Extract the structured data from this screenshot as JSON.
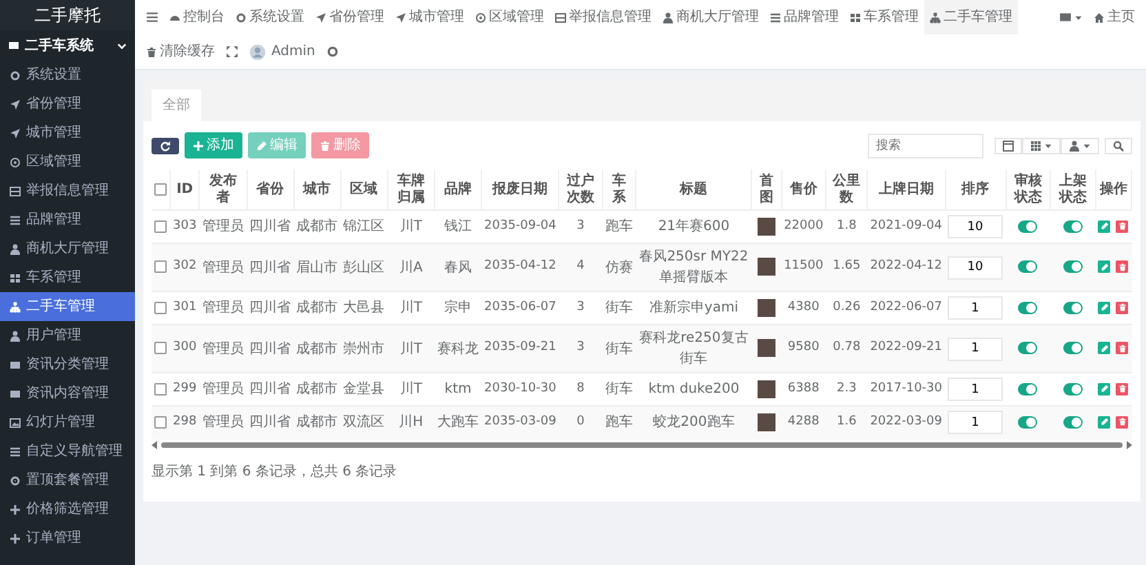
{
  "sidebar": {
    "brand": "二手摩托",
    "group": {
      "label": "二手车系统",
      "expanded": true
    },
    "items": [
      {
        "label": "系统设置",
        "selected": false
      },
      {
        "label": "省份管理",
        "selected": false
      },
      {
        "label": "城市管理",
        "selected": false
      },
      {
        "label": "区域管理",
        "selected": false
      },
      {
        "label": "举报信息管理",
        "selected": false
      },
      {
        "label": "品牌管理",
        "selected": false
      },
      {
        "label": "商机大厅管理",
        "selected": false
      },
      {
        "label": "车系管理",
        "selected": false
      },
      {
        "label": "二手车管理",
        "selected": true
      },
      {
        "label": "用户管理",
        "selected": false
      },
      {
        "label": "资讯分类管理",
        "selected": false
      },
      {
        "label": "资讯内容管理",
        "selected": false
      },
      {
        "label": "幻灯片管理",
        "selected": false
      },
      {
        "label": "自定义导航管理",
        "selected": false
      },
      {
        "label": "置顶套餐管理",
        "selected": false
      },
      {
        "label": "价格筛选管理",
        "selected": false
      },
      {
        "label": "订单管理",
        "selected": false
      }
    ]
  },
  "topnav": {
    "items": [
      {
        "label": "控制台",
        "selected": false
      },
      {
        "label": "系统设置",
        "selected": false
      },
      {
        "label": "省份管理",
        "selected": false
      },
      {
        "label": "城市管理",
        "selected": false
      },
      {
        "label": "区域管理",
        "selected": false
      },
      {
        "label": "举报信息管理",
        "selected": false
      },
      {
        "label": "商机大厅管理",
        "selected": false
      },
      {
        "label": "品牌管理",
        "selected": false
      },
      {
        "label": "车系管理",
        "selected": false
      },
      {
        "label": "二手车管理",
        "selected": true
      }
    ],
    "links": [
      {
        "label": "主页"
      },
      {
        "label": "清除缓存"
      }
    ],
    "user": "Admin"
  },
  "tabs": [
    {
      "label": "全部",
      "selected": true
    }
  ],
  "toolbar": {
    "buttons": [
      {
        "kind": "refresh",
        "disabled": false
      },
      {
        "kind": "add",
        "label": "添加",
        "disabled": false
      },
      {
        "kind": "edit",
        "label": "编辑",
        "disabled": true
      },
      {
        "kind": "delete",
        "label": "删除",
        "disabled": true
      }
    ],
    "search": {
      "placeholder": "搜索"
    }
  },
  "table": {
    "select_all": {
      "checked": false
    },
    "columns": [
      "ID",
      "发布者",
      "省份",
      "城市",
      "区域",
      "车牌归属",
      "品牌",
      "报废日期",
      "过户次数",
      "车系",
      "标题",
      "首图",
      "售价",
      "公里数",
      "上牌日期",
      "排序",
      "审核状态",
      "上架状态",
      "操作"
    ],
    "rows": [
      {
        "checked": false,
        "cells": [
          "303",
          "管理员",
          "四川省",
          "成都市",
          "锦江区",
          "川T",
          "钱江",
          "2035-09-04",
          "3",
          "跑车",
          "21年赛600"
        ],
        "price": "22000",
        "mileage": "1.8",
        "reg_date": "2021-09-04",
        "sort": "10",
        "audit_on": true,
        "listed_on": true
      },
      {
        "checked": false,
        "cells": [
          "302",
          "管理员",
          "四川省",
          "眉山市",
          "彭山区",
          "川A",
          "春风",
          "2035-04-12",
          "4",
          "仿赛",
          "春风250sr MY22单摇臂版本"
        ],
        "price": "11500",
        "mileage": "1.65",
        "reg_date": "2022-04-12",
        "sort": "10",
        "audit_on": true,
        "listed_on": true
      },
      {
        "checked": false,
        "cells": [
          "301",
          "管理员",
          "四川省",
          "成都市",
          "大邑县",
          "川T",
          "宗申",
          "2035-06-07",
          "3",
          "街车",
          "准新宗申yami"
        ],
        "price": "4380",
        "mileage": "0.26",
        "reg_date": "2022-06-07",
        "sort": "1",
        "audit_on": true,
        "listed_on": true
      },
      {
        "checked": false,
        "cells": [
          "300",
          "管理员",
          "四川省",
          "成都市",
          "崇州市",
          "川T",
          "赛科龙",
          "2035-09-21",
          "3",
          "街车",
          "赛科龙re250复古街车"
        ],
        "price": "9580",
        "mileage": "0.78",
        "reg_date": "2022-09-21",
        "sort": "1",
        "audit_on": true,
        "listed_on": true
      },
      {
        "checked": false,
        "cells": [
          "299",
          "管理员",
          "四川省",
          "成都市",
          "金堂县",
          "川T",
          "ktm",
          "2030-10-30",
          "8",
          "街车",
          "ktm duke200"
        ],
        "price": "6388",
        "mileage": "2.3",
        "reg_date": "2017-10-30",
        "sort": "1",
        "audit_on": true,
        "listed_on": true
      },
      {
        "checked": false,
        "cells": [
          "298",
          "管理员",
          "四川省",
          "成都市",
          "双流区",
          "川H",
          "大跑车",
          "2035-03-09",
          "0",
          "跑车",
          "蛟龙200跑车"
        ],
        "price": "4288",
        "mileage": "1.6",
        "reg_date": "2022-03-09",
        "sort": "1",
        "audit_on": true,
        "listed_on": true
      }
    ]
  },
  "footer": "显示第 1 到第 6 条记录，总共 6 条记录"
}
